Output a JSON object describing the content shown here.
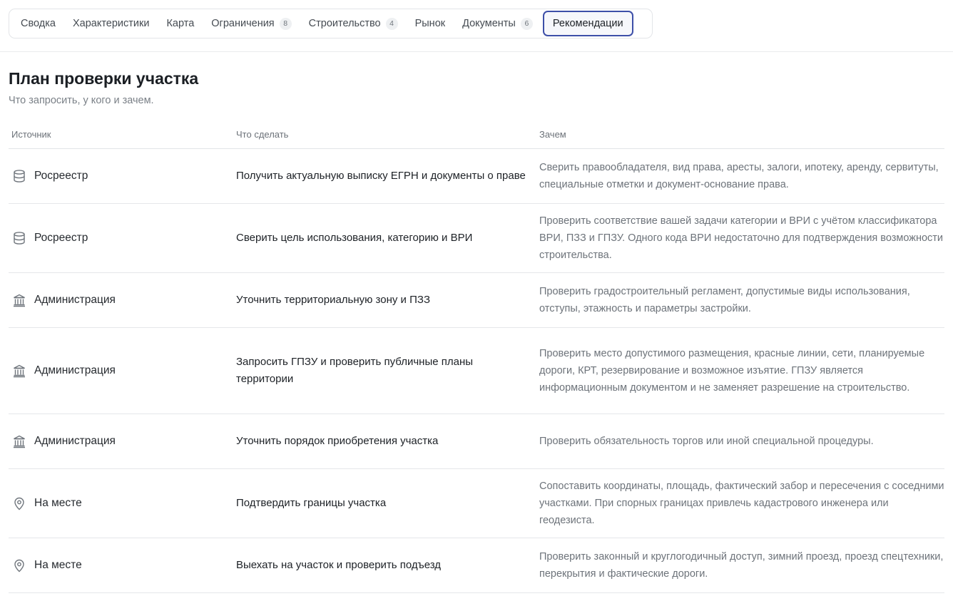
{
  "tabs": [
    {
      "label": "Сводка",
      "badge": null,
      "active": false
    },
    {
      "label": "Характеристики",
      "badge": null,
      "active": false
    },
    {
      "label": "Карта",
      "badge": null,
      "active": false
    },
    {
      "label": "Ограничения",
      "badge": "8",
      "active": false
    },
    {
      "label": "Строительство",
      "badge": "4",
      "active": false
    },
    {
      "label": "Рынок",
      "badge": null,
      "active": false
    },
    {
      "label": "Документы",
      "badge": "6",
      "active": false
    },
    {
      "label": "Рекомендации",
      "badge": null,
      "active": true
    }
  ],
  "page": {
    "title": "План проверки участка",
    "subtitle": "Что запросить, у кого и зачем."
  },
  "table": {
    "headers": {
      "source": "Источник",
      "action": "Что сделать",
      "reason": "Зачем"
    },
    "rows": [
      {
        "icon": "database-icon",
        "source": "Росреестр",
        "action": "Получить актуальную выписку ЕГРН и документы о праве",
        "reason": "Сверить правообладателя, вид права, аресты, залоги, ипотеку, аренду, сервитуты, специальные отметки и документ-основание права."
      },
      {
        "icon": "database-icon",
        "source": "Росреестр",
        "action": "Сверить цель использования, категорию и ВРИ",
        "reason": "Проверить соответствие вашей задачи категории и ВРИ с учётом классификатора ВРИ, ПЗЗ и ГПЗУ. Одного кода ВРИ недостаточно для подтверждения возможности строительства."
      },
      {
        "icon": "government-building-icon",
        "source": "Администрация",
        "action": "Уточнить территориальную зону и ПЗЗ",
        "reason": "Проверить градостроительный регламент, допустимые виды использования, отступы, этажность и параметры застройки."
      },
      {
        "icon": "government-building-icon",
        "source": "Администрация",
        "action": "Запросить ГПЗУ и проверить публичные планы территории",
        "reason": "Проверить место допустимого размещения, красные линии, сети, планируемые дороги, КРТ, резервирование и возможное изъятие. ГПЗУ является информационным документом и не заменяет разрешение на строительство."
      },
      {
        "icon": "government-building-icon",
        "source": "Администрация",
        "action": "Уточнить порядок приобретения участка",
        "reason": "Проверить обязательность торгов или иной специальной процедуры."
      },
      {
        "icon": "map-pin-icon",
        "source": "На месте",
        "action": "Подтвердить границы участка",
        "reason": "Сопоставить координаты, площадь, фактический забор и пересечения с соседними участками. При спорных границах привлечь кадастрового инженера или геодезиста."
      },
      {
        "icon": "map-pin-icon",
        "source": "На месте",
        "action": "Выехать на участок и проверить подъезд",
        "reason": "Проверить законный и круглогодичный доступ, зимний проезд, проезд спецтехники, перекрытия и фактические дороги."
      }
    ]
  }
}
